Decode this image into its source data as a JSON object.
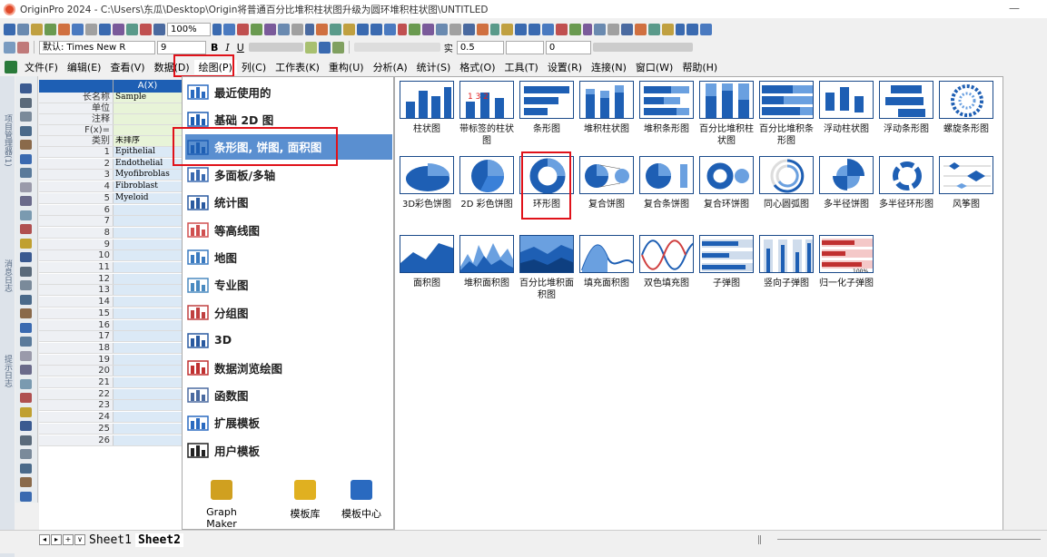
{
  "window": {
    "title": "OriginPro 2024 - C:\\Users\\东瓜\\Desktop\\Origin将普通百分比堆积柱状图升级为圆环堆积柱状图\\UNTITLED",
    "minimize": "—"
  },
  "toolbar": {
    "zoom": "100%",
    "font": "默认: Times New R",
    "font_size": "9",
    "line_width": "0.5",
    "fill_value": "0",
    "line_style": "实",
    "bold": "B",
    "italic": "I",
    "underline": "U"
  },
  "menubar": [
    "文件(F)",
    "编辑(E)",
    "查看(V)",
    "数据(D)",
    "绘图(P)",
    "列(C)",
    "工作表(K)",
    "重构(U)",
    "分析(A)",
    "统计(S)",
    "格式(O)",
    "工具(T)",
    "设置(R)",
    "连接(N)",
    "窗口(W)",
    "帮助(H)"
  ],
  "side_tabs": [
    "项目管理器(1)",
    "消息日志",
    "提示日志"
  ],
  "sheet": {
    "col_header": "A(X)",
    "meta_rows": [
      {
        "label": "长名称",
        "value": "Sample"
      },
      {
        "label": "单位",
        "value": ""
      },
      {
        "label": "注释",
        "value": ""
      },
      {
        "label": "F(x)=",
        "value": ""
      },
      {
        "label": "类别",
        "value": "未排序"
      }
    ],
    "data_rows": [
      {
        "n": "1",
        "v": "Epithelial"
      },
      {
        "n": "2",
        "v": "Endothelial"
      },
      {
        "n": "3",
        "v": "Myofibroblas"
      },
      {
        "n": "4",
        "v": "Fibroblast"
      },
      {
        "n": "5",
        "v": "Myeloid"
      },
      {
        "n": "6",
        "v": ""
      },
      {
        "n": "7",
        "v": ""
      },
      {
        "n": "8",
        "v": ""
      },
      {
        "n": "9",
        "v": ""
      },
      {
        "n": "10",
        "v": ""
      },
      {
        "n": "11",
        "v": ""
      },
      {
        "n": "12",
        "v": ""
      },
      {
        "n": "13",
        "v": ""
      },
      {
        "n": "14",
        "v": ""
      },
      {
        "n": "15",
        "v": ""
      },
      {
        "n": "16",
        "v": ""
      },
      {
        "n": "17",
        "v": ""
      },
      {
        "n": "18",
        "v": ""
      },
      {
        "n": "19",
        "v": ""
      },
      {
        "n": "20",
        "v": ""
      },
      {
        "n": "21",
        "v": ""
      },
      {
        "n": "22",
        "v": ""
      },
      {
        "n": "23",
        "v": ""
      },
      {
        "n": "24",
        "v": ""
      },
      {
        "n": "25",
        "v": ""
      },
      {
        "n": "26",
        "v": ""
      }
    ],
    "tabs": [
      "Sheet1",
      "Sheet2"
    ]
  },
  "plot_menu": {
    "items": [
      "最近使用的",
      "基础 2D 图",
      "条形图, 饼图, 面积图",
      "多面板/多轴",
      "统计图",
      "等高线图",
      "地图",
      "专业图",
      "分组图",
      "3D",
      "数据浏览绘图",
      "函数图",
      "扩展模板",
      "用户模板"
    ],
    "selected": 2,
    "bottom": [
      "Graph Maker",
      "模板库",
      "模板中心"
    ]
  },
  "gallery": {
    "row1": [
      "柱状图",
      "带标签的柱状图",
      "条形图",
      "堆积柱状图",
      "堆积条形图",
      "百分比堆积柱状图",
      "百分比堆积条形图",
      "浮动柱状图",
      "浮动条形图",
      "螺旋条形图"
    ],
    "row2": [
      "3D彩色饼图",
      "2D 彩色饼图",
      "环形图",
      "复合饼图",
      "复合条饼图",
      "复合环饼图",
      "同心圆弧图",
      "多半径饼图",
      "多半径环形图",
      "风筝图"
    ],
    "row3": [
      "面积图",
      "堆积面积图",
      "百分比堆积面积图",
      "填充面积图",
      "双色填充图",
      "子弹图",
      "竖向子弹图",
      "归一化子弹图"
    ],
    "label_123": "1 3 2",
    "label_100": "100%"
  },
  "colors": {
    "accent": "#1e5fb4",
    "highlight": "#e0121a",
    "menu_selected": "#5a8fd0"
  }
}
